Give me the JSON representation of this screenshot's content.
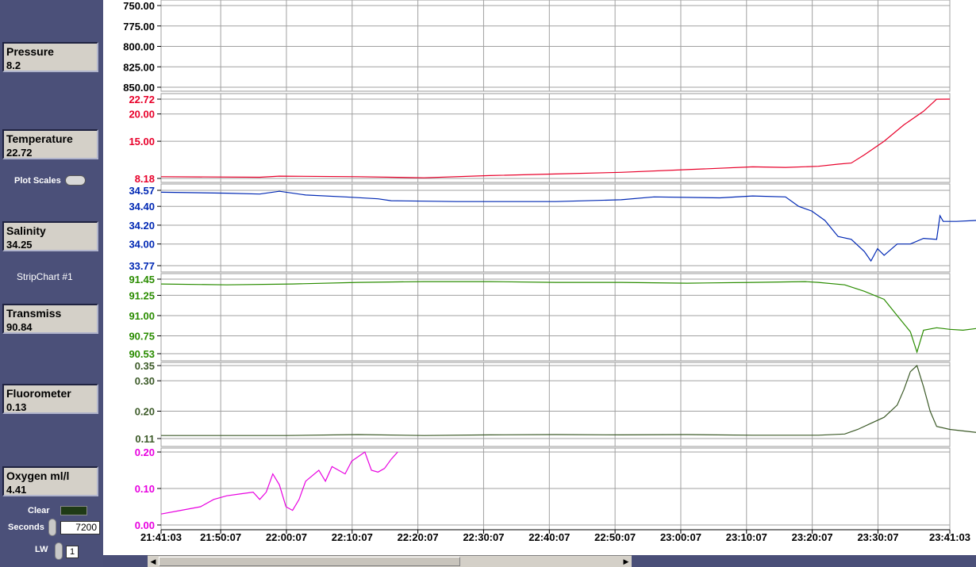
{
  "indicators": [
    {
      "key": "pressure",
      "label": "Pressure",
      "value": "8.2"
    },
    {
      "key": "temperature",
      "label": "Temperature",
      "value": "22.72"
    },
    {
      "key": "salinity",
      "label": "Salinity",
      "value": "34.25"
    },
    {
      "key": "transmiss",
      "label": "Transmiss",
      "value": "90.84"
    },
    {
      "key": "fluorometer",
      "label": "Fluorometer",
      "value": "0.13"
    },
    {
      "key": "oxygen",
      "label": "Oxygen ml/l",
      "value": "4.41"
    }
  ],
  "plot_scales_label": "Plot Scales",
  "stripchart_label": "StripChart #1",
  "clear_label": "Clear",
  "seconds_label": "Seconds",
  "seconds_value": "7200",
  "lw_label": "LW",
  "lw_value": "1",
  "colors": {
    "pressure": "#000000",
    "temperature": "#e8002a",
    "salinity": "#0028b4",
    "transmiss": "#2a8c00",
    "fluorometer": "#3c5a28",
    "oxygen": "#e800e0"
  },
  "chart_data": {
    "type": "line",
    "x_ticks": [
      "21:41:03",
      "21:50:07",
      "22:00:07",
      "22:10:07",
      "22:20:07",
      "22:30:07",
      "22:40:07",
      "22:50:07",
      "23:00:07",
      "23:10:07",
      "23:20:07",
      "23:30:07",
      "23:41:03"
    ],
    "x_minutes": [
      0,
      9.07,
      19.07,
      29.07,
      39.07,
      49.07,
      59.07,
      69.07,
      79.07,
      89.07,
      99.07,
      109.07,
      120
    ],
    "panels": [
      {
        "name": "Pressure",
        "color_key": "pressure",
        "ylim": [
          750,
          850
        ],
        "inverted": true,
        "ticks": [
          "750.00",
          "775.00",
          "800.00",
          "825.00",
          "850.00"
        ],
        "tick_values": [
          750,
          775,
          800,
          825,
          850
        ],
        "series": []
      },
      {
        "name": "Temperature",
        "color_key": "temperature",
        "ylim": [
          8.18,
          22.72
        ],
        "ticks": [
          "22.72",
          "20.00",
          "15.00",
          "8.18"
        ],
        "tick_values": [
          22.72,
          20,
          15,
          8.18
        ],
        "series": [
          [
            0,
            8.5
          ],
          [
            15,
            8.4
          ],
          [
            18,
            8.6
          ],
          [
            30,
            8.5
          ],
          [
            40,
            8.3
          ],
          [
            50,
            8.7
          ],
          [
            60,
            9.0
          ],
          [
            70,
            9.3
          ],
          [
            80,
            9.8
          ],
          [
            90,
            10.3
          ],
          [
            95,
            10.2
          ],
          [
            100,
            10.4
          ],
          [
            103,
            10.8
          ],
          [
            105,
            11.0
          ],
          [
            107,
            12.5
          ],
          [
            110,
            15.0
          ],
          [
            113,
            18.0
          ],
          [
            116,
            20.5
          ],
          [
            118,
            22.7
          ],
          [
            120,
            22.72
          ]
        ]
      },
      {
        "name": "Salinity",
        "color_key": "salinity",
        "ylim": [
          33.77,
          34.57
        ],
        "ticks": [
          "34.57",
          "34.40",
          "34.20",
          "34.00",
          "33.77"
        ],
        "tick_values": [
          34.57,
          34.4,
          34.2,
          34.0,
          33.77
        ],
        "series": [
          [
            0,
            34.55
          ],
          [
            10,
            34.54
          ],
          [
            15,
            34.53
          ],
          [
            18,
            34.56
          ],
          [
            22,
            34.52
          ],
          [
            28,
            34.5
          ],
          [
            33,
            34.48
          ],
          [
            35,
            34.46
          ],
          [
            45,
            34.45
          ],
          [
            60,
            34.45
          ],
          [
            70,
            34.47
          ],
          [
            75,
            34.5
          ],
          [
            85,
            34.49
          ],
          [
            90,
            34.51
          ],
          [
            95,
            34.5
          ],
          [
            97,
            34.4
          ],
          [
            99,
            34.35
          ],
          [
            101,
            34.25
          ],
          [
            103,
            34.08
          ],
          [
            105,
            34.05
          ],
          [
            107,
            33.92
          ],
          [
            108,
            33.82
          ],
          [
            109,
            33.95
          ],
          [
            110,
            33.88
          ],
          [
            112,
            34.0
          ],
          [
            114,
            34.0
          ],
          [
            116,
            34.06
          ],
          [
            118,
            34.05
          ],
          [
            118.5,
            34.3
          ],
          [
            119,
            34.24
          ],
          [
            121,
            34.24
          ],
          [
            124,
            34.25
          ]
        ]
      },
      {
        "name": "Transmiss",
        "color_key": "transmiss",
        "ylim": [
          90.53,
          91.45
        ],
        "ticks": [
          "91.45",
          "91.25",
          "91.00",
          "90.75",
          "90.53"
        ],
        "tick_values": [
          91.45,
          91.25,
          91.0,
          90.75,
          90.53
        ],
        "series": [
          [
            0,
            91.39
          ],
          [
            10,
            91.38
          ],
          [
            20,
            91.39
          ],
          [
            30,
            91.41
          ],
          [
            40,
            91.42
          ],
          [
            50,
            91.42
          ],
          [
            60,
            91.41
          ],
          [
            70,
            91.41
          ],
          [
            80,
            91.4
          ],
          [
            90,
            91.41
          ],
          [
            98,
            91.42
          ],
          [
            100,
            91.41
          ],
          [
            104,
            91.38
          ],
          [
            107,
            91.3
          ],
          [
            110,
            91.2
          ],
          [
            112,
            91.0
          ],
          [
            114,
            90.8
          ],
          [
            115,
            90.55
          ],
          [
            116,
            90.82
          ],
          [
            118,
            90.85
          ],
          [
            120,
            90.83
          ],
          [
            122,
            90.82
          ],
          [
            124,
            90.84
          ]
        ]
      },
      {
        "name": "Fluorometer",
        "color_key": "fluorometer",
        "ylim": [
          0.11,
          0.35
        ],
        "ticks": [
          "0.35",
          "0.30",
          "0.20",
          "0.11"
        ],
        "tick_values": [
          0.35,
          0.3,
          0.2,
          0.11
        ],
        "series": [
          [
            0,
            0.12
          ],
          [
            19,
            0.12
          ],
          [
            30,
            0.123
          ],
          [
            40,
            0.12
          ],
          [
            50,
            0.122
          ],
          [
            60,
            0.123
          ],
          [
            70,
            0.122
          ],
          [
            80,
            0.123
          ],
          [
            90,
            0.121
          ],
          [
            100,
            0.121
          ],
          [
            104,
            0.125
          ],
          [
            106,
            0.14
          ],
          [
            108,
            0.16
          ],
          [
            110,
            0.18
          ],
          [
            112,
            0.22
          ],
          [
            113,
            0.27
          ],
          [
            114,
            0.33
          ],
          [
            115,
            0.35
          ],
          [
            116,
            0.28
          ],
          [
            117,
            0.2
          ],
          [
            118,
            0.15
          ],
          [
            120,
            0.14
          ],
          [
            122,
            0.135
          ],
          [
            124,
            0.13
          ]
        ]
      },
      {
        "name": "Oxygen ml/l",
        "color_key": "oxygen",
        "ylim": [
          0,
          0.2
        ],
        "ticks": [
          "0.20",
          "0.10",
          "0.00"
        ],
        "tick_values": [
          0.2,
          0.1,
          0.0
        ],
        "series": [
          [
            0,
            0.03
          ],
          [
            3,
            0.04
          ],
          [
            6,
            0.05
          ],
          [
            8,
            0.07
          ],
          [
            10,
            0.08
          ],
          [
            12,
            0.085
          ],
          [
            14,
            0.09
          ],
          [
            15,
            0.07
          ],
          [
            16,
            0.09
          ],
          [
            17,
            0.14
          ],
          [
            18,
            0.11
          ],
          [
            19,
            0.05
          ],
          [
            20,
            0.04
          ],
          [
            21,
            0.07
          ],
          [
            22,
            0.12
          ],
          [
            24,
            0.15
          ],
          [
            25,
            0.12
          ],
          [
            26,
            0.16
          ],
          [
            28,
            0.14
          ],
          [
            29,
            0.175
          ],
          [
            31,
            0.2
          ],
          [
            32,
            0.15
          ],
          [
            33,
            0.145
          ],
          [
            34,
            0.155
          ],
          [
            35,
            0.18
          ],
          [
            36,
            0.2
          ]
        ]
      }
    ]
  }
}
